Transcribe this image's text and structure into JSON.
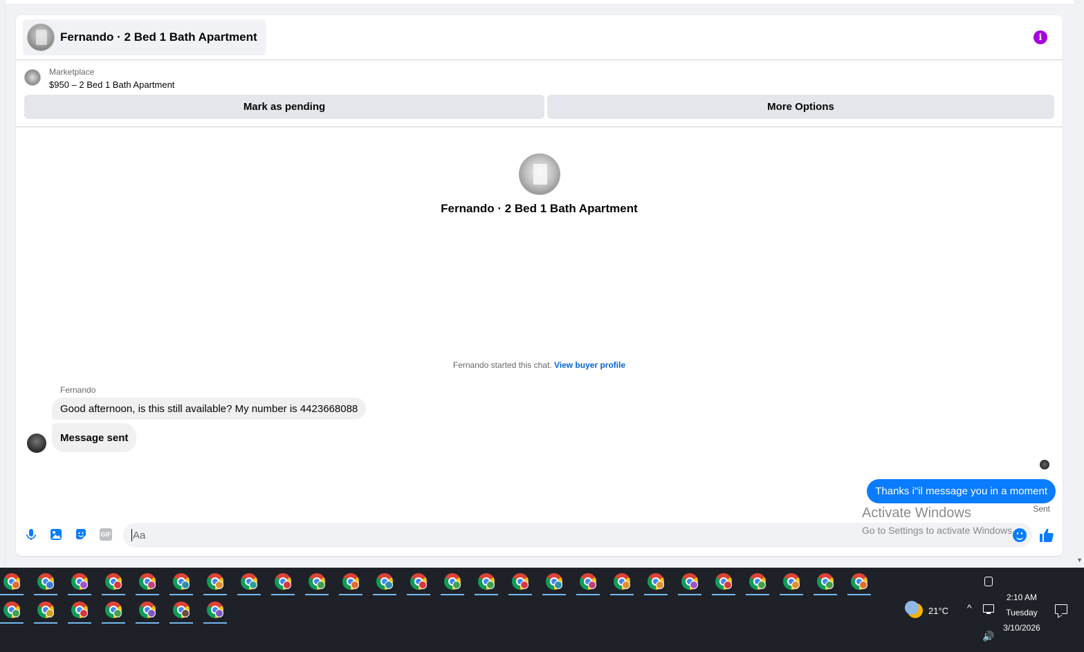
{
  "header": {
    "title": "Fernando · 2 Bed 1 Bath Apartment",
    "info_icon": "info-icon",
    "info_glyph": "i"
  },
  "listing": {
    "source": "Marketplace",
    "price_title": "$950 – 2 Bed 1 Bath Apartment",
    "pending_label": "Mark as pending",
    "more_label": "More Options"
  },
  "conversation": {
    "name": "Fernando · 2 Bed 1 Bath Apartment",
    "started_text": "Fernando started this chat.",
    "view_profile_link": "View buyer profile",
    "sender_name": "Fernando",
    "messages_in": [
      "Good afternoon, is this still available? My number is 4423668088",
      "Message sent"
    ],
    "message_out": "Thanks i\"il message you in a moment",
    "status": "Sent"
  },
  "composer": {
    "placeholder": "Aa",
    "icons": [
      "microphone-icon",
      "image-icon",
      "sticker-icon",
      "gif-icon",
      "emoji-icon",
      "thumbs-up-icon"
    ],
    "gif_label": "GIF"
  },
  "watermark": {
    "title": "Activate Windows",
    "subtitle": "Go to Settings to activate Windows."
  },
  "taskbar": {
    "weather_temp": "21°C",
    "time": "2:10 AM",
    "day": "Tuesday",
    "date": "3/10/2026",
    "chevron": "^",
    "sound": "🔊",
    "badge_colors": [
      "#e06c2e",
      "#3b7dd8",
      "#a050c8",
      "#d9363e",
      "#c2407a",
      "#2f8fa8",
      "#e0902e",
      "#2aa198",
      "#d9363e",
      "#44a04a",
      "#e06c2e",
      "#2f8fa8",
      "#d9363e",
      "#44a04a",
      "#44a04a",
      "#d9363e",
      "#2f8fa8",
      "#c2407a",
      "#e0902e",
      "#e0902e",
      "#a050c8",
      "#d9363e",
      "#44a04a",
      "#e0902e",
      "#44a04a",
      "#e06c2e",
      "#44a04a",
      "#c9a227",
      "#d9363e",
      "#44a04a",
      "#7e57c2",
      "#6d4c41",
      "#7e57c2"
    ]
  }
}
